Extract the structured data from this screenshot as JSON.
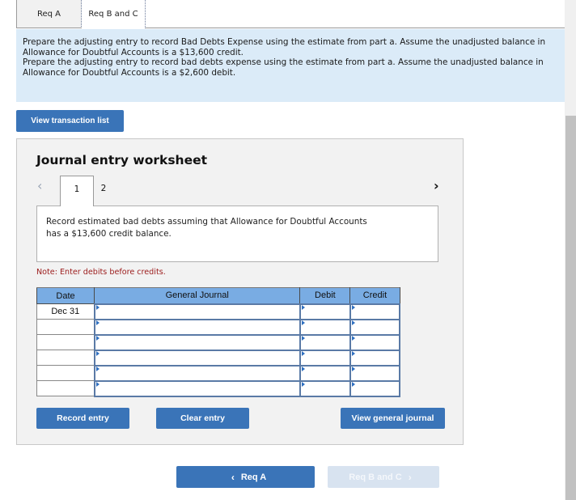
{
  "tabs": [
    {
      "label": "Req A",
      "active": false
    },
    {
      "label": "Req B and C",
      "active": true
    }
  ],
  "instructions": [
    "Prepare the adjusting entry to record Bad Debts Expense using the estimate from part a. Assume the unadjusted balance in",
    "Allowance for Doubtful Accounts is a $13,600 credit.",
    "Prepare the adjusting entry to record bad debts expense using the estimate from part a. Assume the unadjusted balance in",
    "Allowance for Doubtful Accounts is a $2,600 debit."
  ],
  "buttons": {
    "view_transaction_list": "View transaction list",
    "record_entry": "Record entry",
    "clear_entry": "Clear entry",
    "view_general_journal": "View general journal"
  },
  "worksheet": {
    "title": "Journal entry worksheet",
    "pages": [
      "1",
      "2"
    ],
    "current_page": "1",
    "prev_icon": "‹",
    "next_icon": "›",
    "description_line1": "Record estimated bad debts assuming that Allowance for Doubtful Accounts",
    "description_line2": "has a $13,600 credit balance.",
    "note": "Note: Enter debits before credits."
  },
  "journal": {
    "headers": {
      "date": "Date",
      "general_journal": "General Journal",
      "debit": "Debit",
      "credit": "Credit"
    },
    "rows": [
      {
        "date": "Dec 31",
        "account": "",
        "debit": "",
        "credit": ""
      },
      {
        "date": "",
        "account": "",
        "debit": "",
        "credit": ""
      },
      {
        "date": "",
        "account": "",
        "debit": "",
        "credit": ""
      },
      {
        "date": "",
        "account": "",
        "debit": "",
        "credit": ""
      },
      {
        "date": "",
        "account": "",
        "debit": "",
        "credit": ""
      },
      {
        "date": "",
        "account": "",
        "debit": "",
        "credit": ""
      }
    ]
  },
  "bottom_nav": {
    "prev_label": "Req A",
    "next_label": "Req B and C",
    "prev_icon": "‹",
    "next_icon": "›"
  }
}
